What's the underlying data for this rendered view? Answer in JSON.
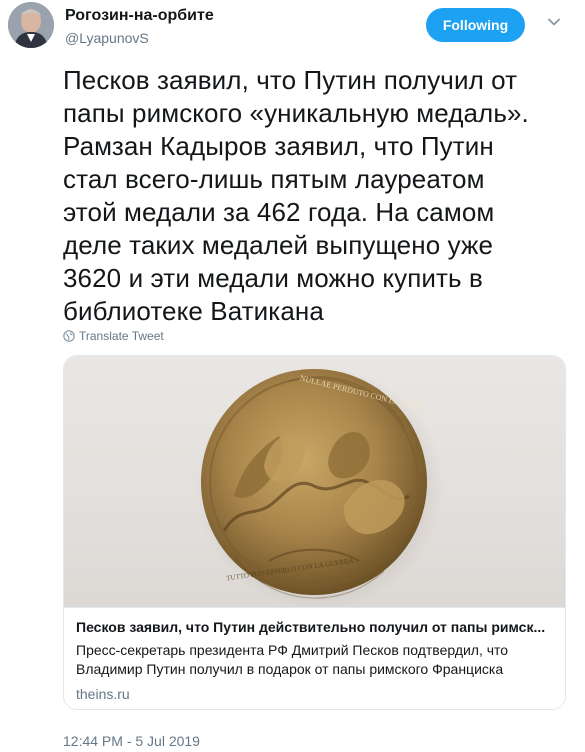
{
  "user": {
    "display_name": "Рогозин-на-орбите",
    "handle": "@LyapunovS"
  },
  "header": {
    "follow_label": "Following"
  },
  "tweet": {
    "lines": [
      "Песков заявил, что Путин получил от",
      "папы римского «уникальную медаль».",
      "Рамзан Кадыров заявил, что Путин",
      "стал всего-лишь пятым лауреатом",
      "этой медали за 462 года. На самом",
      "деле таких медалей выпущено уже",
      "3620 и эти медали можно купить в",
      "библиотеке Ватикана"
    ],
    "translate_label": "Translate Tweet",
    "timestamp": "12:44 PM - 5 Jul 2019"
  },
  "card": {
    "title": "Песков заявил, что Путин действительно получил от папы римск...",
    "description": "Пресс-секретарь президента РФ Дмитрий Песков подтвердил, что Владимир Путин получил в подарок от папы римского Франциска",
    "domain": "theins.ru",
    "medal_text_top": "NULLAE PERDUTO CON LA PACE",
    "medal_text_bottom": "TUTTO PUO ESSERLO CON LA GUERRA"
  },
  "colors": {
    "accent": "#1da1f2",
    "muted": "#657786",
    "border": "#e1e8ed",
    "medal": "#a8844a"
  }
}
